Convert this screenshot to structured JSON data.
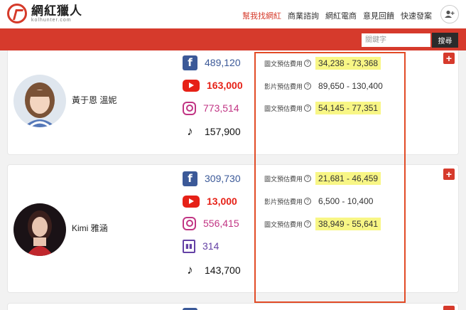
{
  "header": {
    "logo_title": "網紅獵人",
    "logo_sub": "kolhunter.com",
    "nav": [
      "幫我找網紅",
      "商業諮詢",
      "網紅電商",
      "意見回饋",
      "快速發案"
    ]
  },
  "search": {
    "placeholder": "關鍵字",
    "button": "搜尋"
  },
  "price_labels": {
    "post": "圖文預估費用",
    "video": "影片預估費用"
  },
  "influencers": [
    {
      "name": "黃于恩 溫妮",
      "facebook": "489,120",
      "youtube": "163,000",
      "instagram": "773,514",
      "tiktok": "157,900",
      "post_fb": "34,238 - 73,368",
      "video": "89,650 - 130,400",
      "post_ig": "54,145 - 77,351"
    },
    {
      "name": "Kimi 雅涵",
      "facebook": "309,730",
      "youtube": "13,000",
      "instagram": "556,415",
      "twitch": "314",
      "tiktok": "143,700",
      "post_fb": "21,681 - 46,459",
      "video": "6,500 - 10,400",
      "post_ig": "38,949 - 55,641"
    }
  ],
  "colors": {
    "brand": "#d63a2c",
    "highlight": "#f8f685",
    "annotation_box": "#e24b26"
  }
}
